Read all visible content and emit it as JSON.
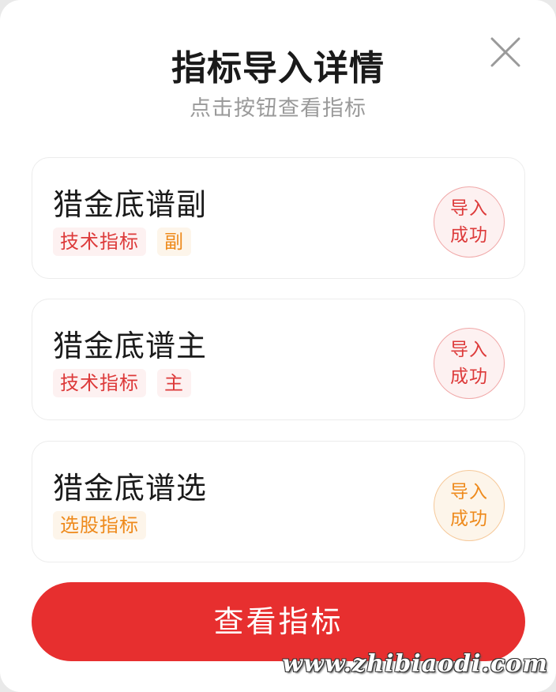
{
  "dialog": {
    "title": "指标导入详情",
    "subtitle": "点击按钮查看指标",
    "close_icon": "close-icon"
  },
  "cards": [
    {
      "name": "猎金底谱副",
      "tags": [
        {
          "label": "技术指标",
          "color": "#dd3a3a"
        },
        {
          "label": "副",
          "color": "#ee8a1c"
        }
      ],
      "status_line1": "导入",
      "status_line2": "成功",
      "status_color": "#dd3a3a"
    },
    {
      "name": "猎金底谱主",
      "tags": [
        {
          "label": "技术指标",
          "color": "#dd3a3a"
        },
        {
          "label": "主",
          "color": "#dd3a3a"
        }
      ],
      "status_line1": "导入",
      "status_line2": "成功",
      "status_color": "#dd3a3a"
    },
    {
      "name": "猎金底谱选",
      "tags": [
        {
          "label": "选股指标",
          "color": "#ee8a1c"
        }
      ],
      "status_line1": "导入",
      "status_line2": "成功",
      "status_color": "#ee8a1c"
    }
  ],
  "primary_button": {
    "label": "查看指标",
    "color": "#e72f2f"
  },
  "watermark": "www.zhibiaodi.com"
}
